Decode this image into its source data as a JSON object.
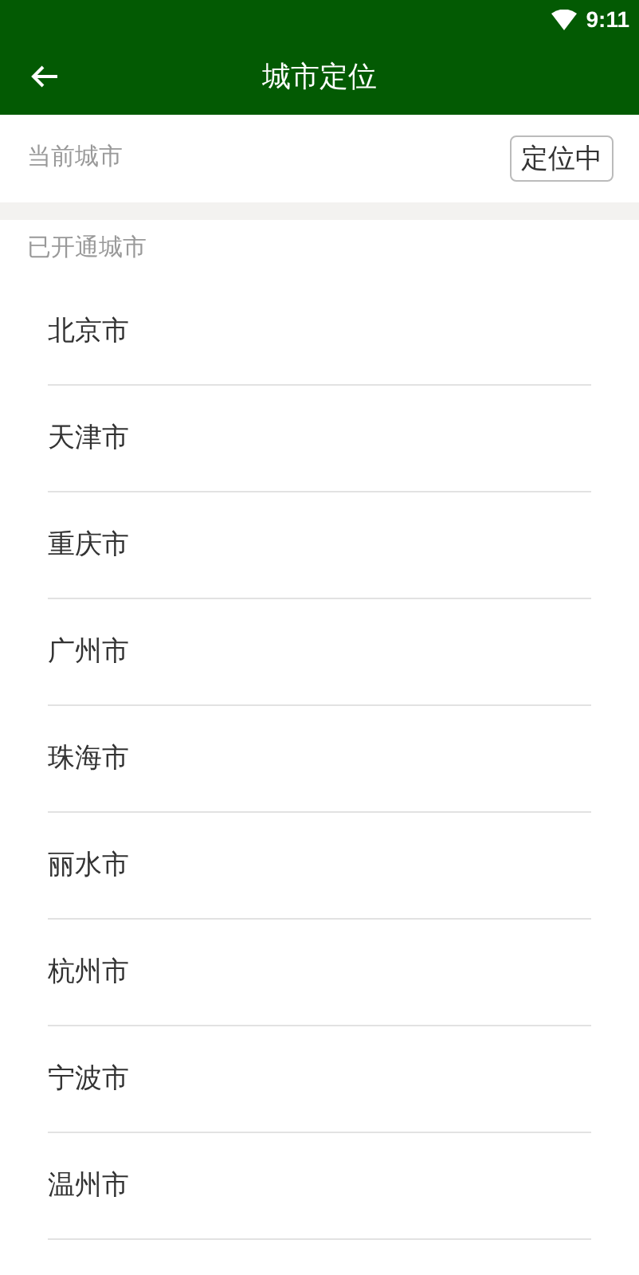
{
  "status_bar": {
    "time": "9:11"
  },
  "toolbar": {
    "title": "城市定位"
  },
  "current_city": {
    "label": "当前城市",
    "button": "定位中"
  },
  "opened_cities": {
    "label": "已开通城市",
    "items": [
      "北京市",
      "天津市",
      "重庆市",
      "广州市",
      "珠海市",
      "丽水市",
      "杭州市",
      "宁波市",
      "温州市"
    ]
  }
}
